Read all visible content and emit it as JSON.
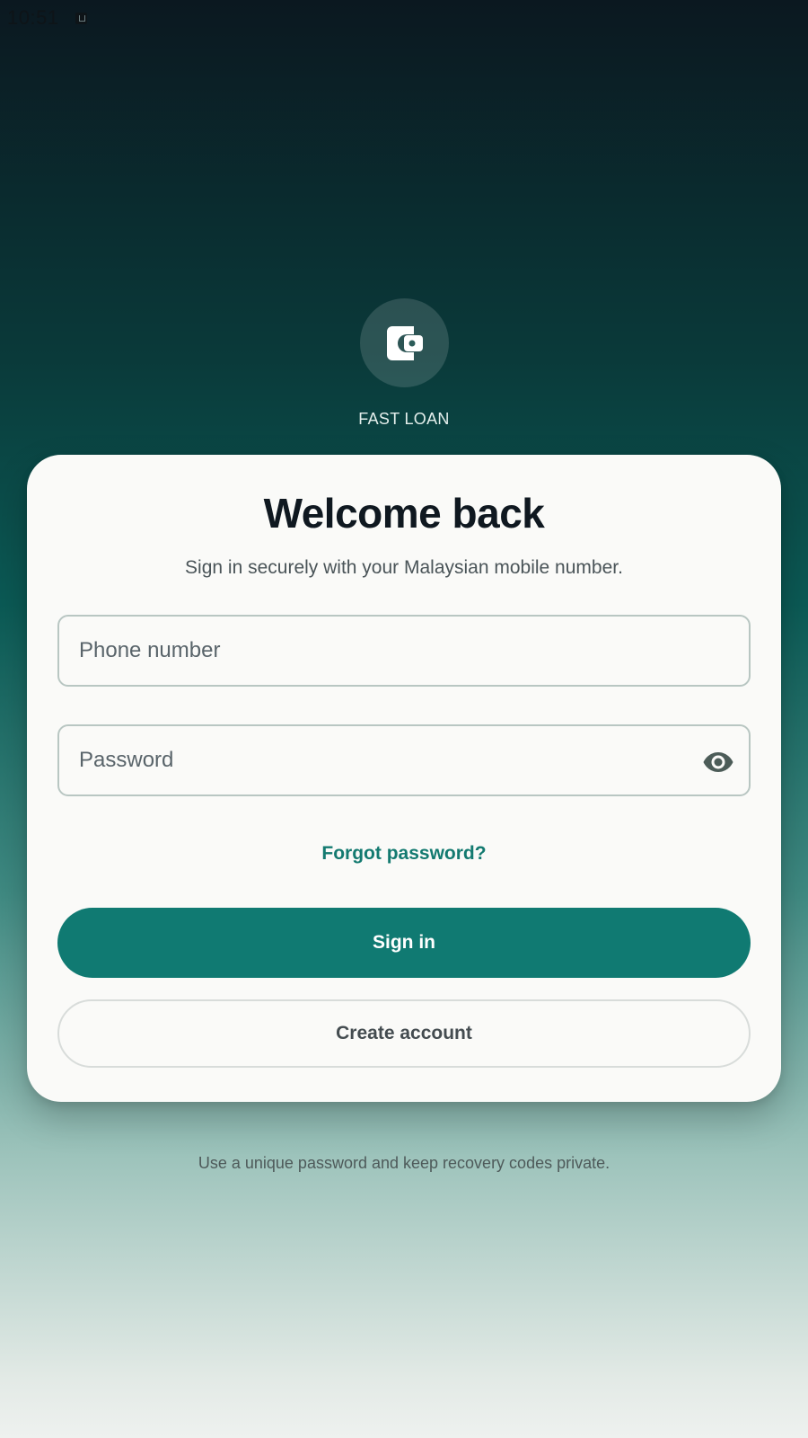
{
  "status_bar": {
    "time": "10:51",
    "notification_icon": "notification-icon"
  },
  "brand": {
    "icon": "wallet-icon",
    "name": "FAST LOAN"
  },
  "card": {
    "title": "Welcome back",
    "subtitle": "Sign in securely with your Malaysian mobile number.",
    "phone": {
      "placeholder": "Phone number",
      "value": ""
    },
    "password": {
      "placeholder": "Password",
      "value": "",
      "toggle_icon": "eye-icon"
    },
    "forgot_label": "Forgot password?",
    "signin_label": "Sign in",
    "create_label": "Create account"
  },
  "footer": {
    "note": "Use a unique password and keep recovery codes private."
  },
  "colors": {
    "accent": "#107a72",
    "link": "#137a70",
    "title": "#0f1820"
  }
}
